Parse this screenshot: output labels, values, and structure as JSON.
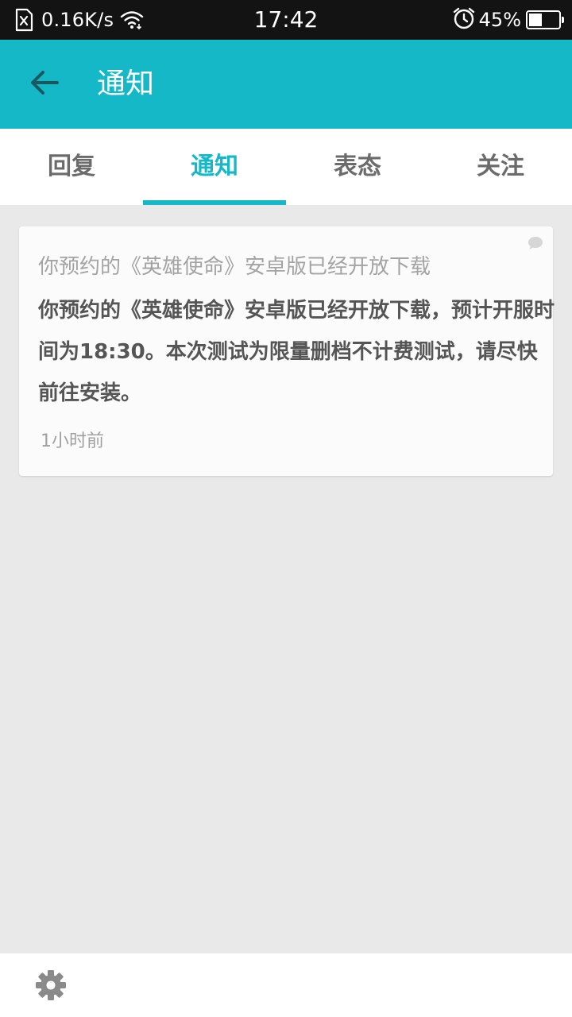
{
  "status_bar": {
    "speed": "0.16K/s",
    "time": "17:42",
    "battery_text": "45%",
    "battery_level": 0.45
  },
  "app_bar": {
    "title": "通知"
  },
  "tabs": [
    {
      "label": "回复",
      "active": false
    },
    {
      "label": "通知",
      "active": true
    },
    {
      "label": "表态",
      "active": false
    },
    {
      "label": "关注",
      "active": false
    }
  ],
  "notification": {
    "title": "你预约的《英雄使命》安卓版已经开放下载",
    "body": "你预约的《英雄使命》安卓版已经开放下载，预计开服时间为18:30。本次测试为限量删档不计费测试，请尽快前往安装。",
    "time": "1小时前"
  },
  "colors": {
    "accent": "#14b8c7",
    "status_bar": "#131313",
    "background": "#e9e9e9"
  },
  "icons": {
    "sim": "sim-card-icon",
    "wifi": "wifi-icon",
    "alarm": "alarm-clock-icon",
    "battery": "battery-icon",
    "back": "arrow-left-icon",
    "chat": "chat-bubble-icon",
    "settings": "gear-icon"
  }
}
